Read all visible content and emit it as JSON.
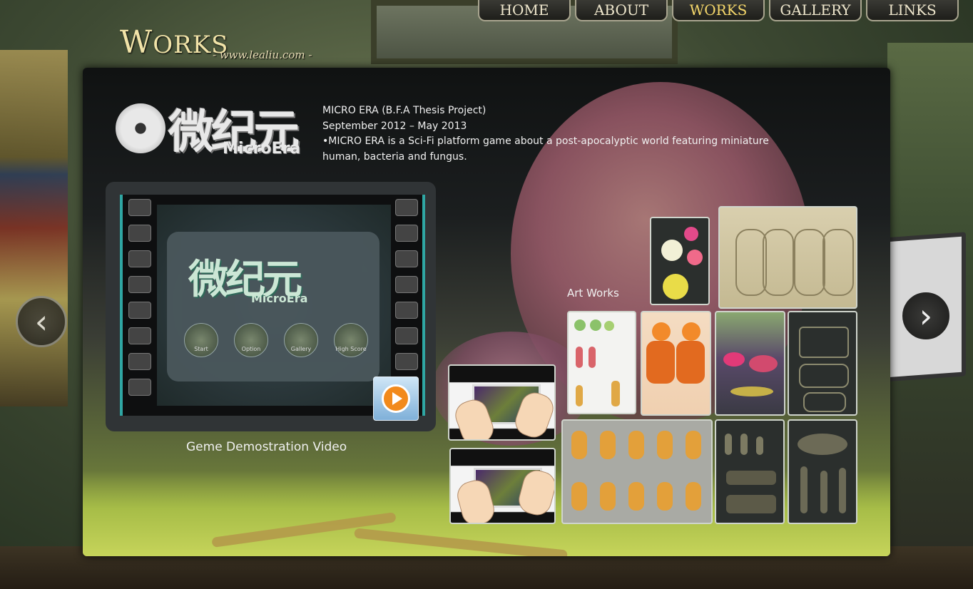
{
  "site": {
    "title_first": "W",
    "title_rest": "ORKS",
    "url": "- www.lealiu.com -"
  },
  "nav": [
    {
      "label": "HOME"
    },
    {
      "label": "ABOUT"
    },
    {
      "label": "WORKS"
    },
    {
      "label": "GALLERY"
    },
    {
      "label": "LINKS"
    }
  ],
  "project": {
    "logo_cjk": "微纪元",
    "logo_latin": "MicroEra",
    "title": "MICRO ERA (B.F.A Thesis Project)",
    "dates": "September 2012 – May 2013",
    "description_line1": "•MICRO ERA is a Sci-Fi platform game about a post-apocalyptic world featuring miniature",
    "description_line2": "human, bacteria and fungus."
  },
  "video": {
    "screen_logo": "微纪元",
    "screen_logo_sub": "MicroEra",
    "menu": [
      "Start",
      "Option",
      "Gallery",
      "High Score"
    ],
    "caption": "Geme Demostration Video",
    "play_icon": "play-icon"
  },
  "art": {
    "label": "Art Works"
  },
  "nav_arrows": {
    "left_icon": "chevron-left-icon",
    "right_icon": "chevron-right-icon",
    "left_glyph": "‹",
    "right_glyph": "›"
  },
  "colors": {
    "accent_orange": "#f28a1c",
    "film_teal": "#2fa6a3",
    "nav_active": "#f6d86b"
  }
}
